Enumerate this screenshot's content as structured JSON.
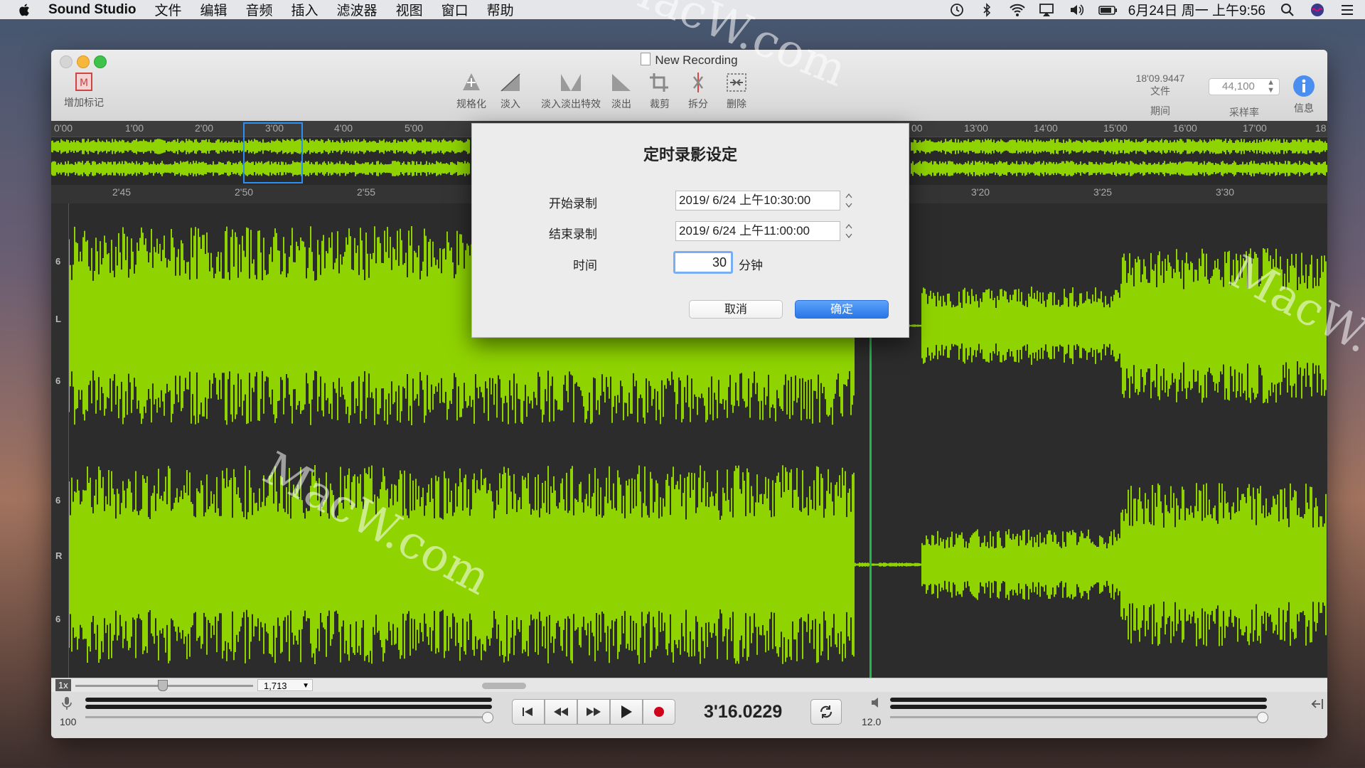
{
  "menubar": {
    "app_name": "Sound Studio",
    "items": [
      "文件",
      "编辑",
      "音频",
      "插入",
      "滤波器",
      "视图",
      "窗口",
      "帮助"
    ],
    "clock": "6月24日 周一 上午9:56"
  },
  "window": {
    "title": "New Recording",
    "add_marker_label": "增加标记",
    "tools": [
      {
        "label": "规格化",
        "icon": "normalize-icon"
      },
      {
        "label": "淡入",
        "icon": "fade-in-icon"
      },
      {
        "label": "淡入淡出特效",
        "icon": "crossfade-icon"
      },
      {
        "label": "淡出",
        "icon": "fade-out-icon"
      },
      {
        "label": "裁剪",
        "icon": "crop-icon"
      },
      {
        "label": "拆分",
        "icon": "split-icon"
      },
      {
        "label": "删除",
        "icon": "delete-icon"
      }
    ],
    "file_duration": "18'09.9447",
    "file_label": "文件",
    "period_label": "期间",
    "sample_rate": "44,100",
    "sample_rate_label": "采样率",
    "info_label": "信息"
  },
  "overview": {
    "ticks_left": [
      "0'00",
      "1'00",
      "2'00",
      "3'00",
      "4'00",
      "5'00"
    ],
    "ticks_right": [
      "00",
      "13'00",
      "14'00",
      "15'00",
      "16'00",
      "17'00",
      "18"
    ]
  },
  "zoom_ruler": {
    "ticks_left": [
      "2'45",
      "2'50",
      "2'55"
    ],
    "ticks_right": [
      "3'20",
      "3'25",
      "3'30"
    ]
  },
  "tracks": {
    "left_labels": [
      "6",
      "L",
      "6"
    ],
    "right_labels": [
      "6",
      "R",
      "6"
    ]
  },
  "bottom": {
    "zoom_label": "1x",
    "zoom_value": "1,713",
    "input_level": "100",
    "time": "3'16.0229",
    "output_level": "12.0"
  },
  "dialog": {
    "title": "定时录影设定",
    "start_label": "开始录制",
    "start_value": "2019/  6/24 上午10:30:00",
    "end_label": "结束录制",
    "end_value": "2019/  6/24 上午11:00:00",
    "duration_label": "时间",
    "duration_value": "30",
    "duration_unit": "分钟",
    "cancel": "取消",
    "ok": "确定"
  },
  "colors": {
    "waveform": "#8fd400",
    "playhead": "#1fb84a",
    "accent": "#2c7be5"
  }
}
